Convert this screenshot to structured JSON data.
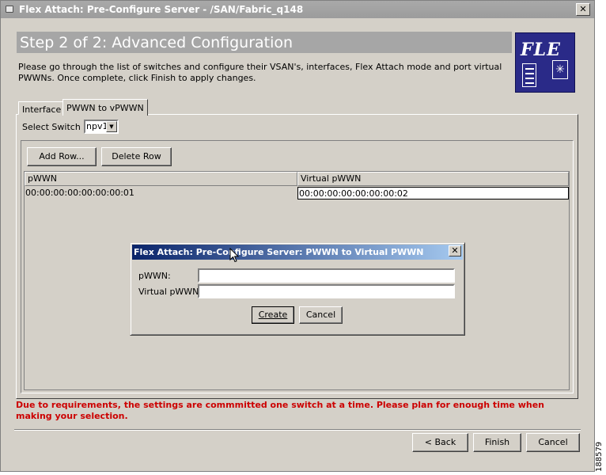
{
  "window": {
    "title": "Flex Attach: Pre-Configure Server - /SAN/Fabric_q148",
    "close_glyph": "✕"
  },
  "header": {
    "step_title": "Step 2 of 2:  Advanced Configuration",
    "instructions": "Please go through the list of switches and configure their VSAN's, interfaces, Flex Attach mode and port virtual PWWNs. Once complete, click Finish to apply changes.",
    "logo_text": "FLE",
    "logo_icons": [
      "server-document-icon",
      "star-box-icon"
    ]
  },
  "tabs": [
    {
      "label": "Interface",
      "selected": false
    },
    {
      "label": "PWWN to vPWWN",
      "selected": true
    }
  ],
  "switch_selector": {
    "label": "Select Switch",
    "value": "npv1"
  },
  "table_buttons": {
    "add_row": "Add Row...",
    "delete_row": "Delete Row"
  },
  "table": {
    "columns": [
      "pWWN",
      "Virtual pWWN"
    ],
    "rows": [
      [
        "00:00:00:00:00:00:00:01",
        "00:00:00:00:00:00:00:02"
      ]
    ]
  },
  "dialog": {
    "title": "Flex Attach: Pre-Configure Server:  PWWN to Virtual PWWN",
    "pwwn_label": "pWWN:",
    "pwwn_value": "",
    "vpwwn_label": "Virtual pWWN:",
    "vpwwn_value": "",
    "create_label": "Create",
    "cancel_label": "Cancel"
  },
  "footer": {
    "warning": "Due to requirements, the settings are commmitted one switch at a time. Please plan for enough time when making your selection.",
    "back_label": "Back",
    "finish_label": "Finish",
    "cancel_label": "Cancel"
  },
  "figure_id": "188579",
  "colors": {
    "window_bg": "#d4d0c8",
    "dialog_title_start": "#0a246a",
    "dialog_title_end": "#a6caf0",
    "warning_text": "#cc0000",
    "logo_bg": "#2a2a88"
  }
}
